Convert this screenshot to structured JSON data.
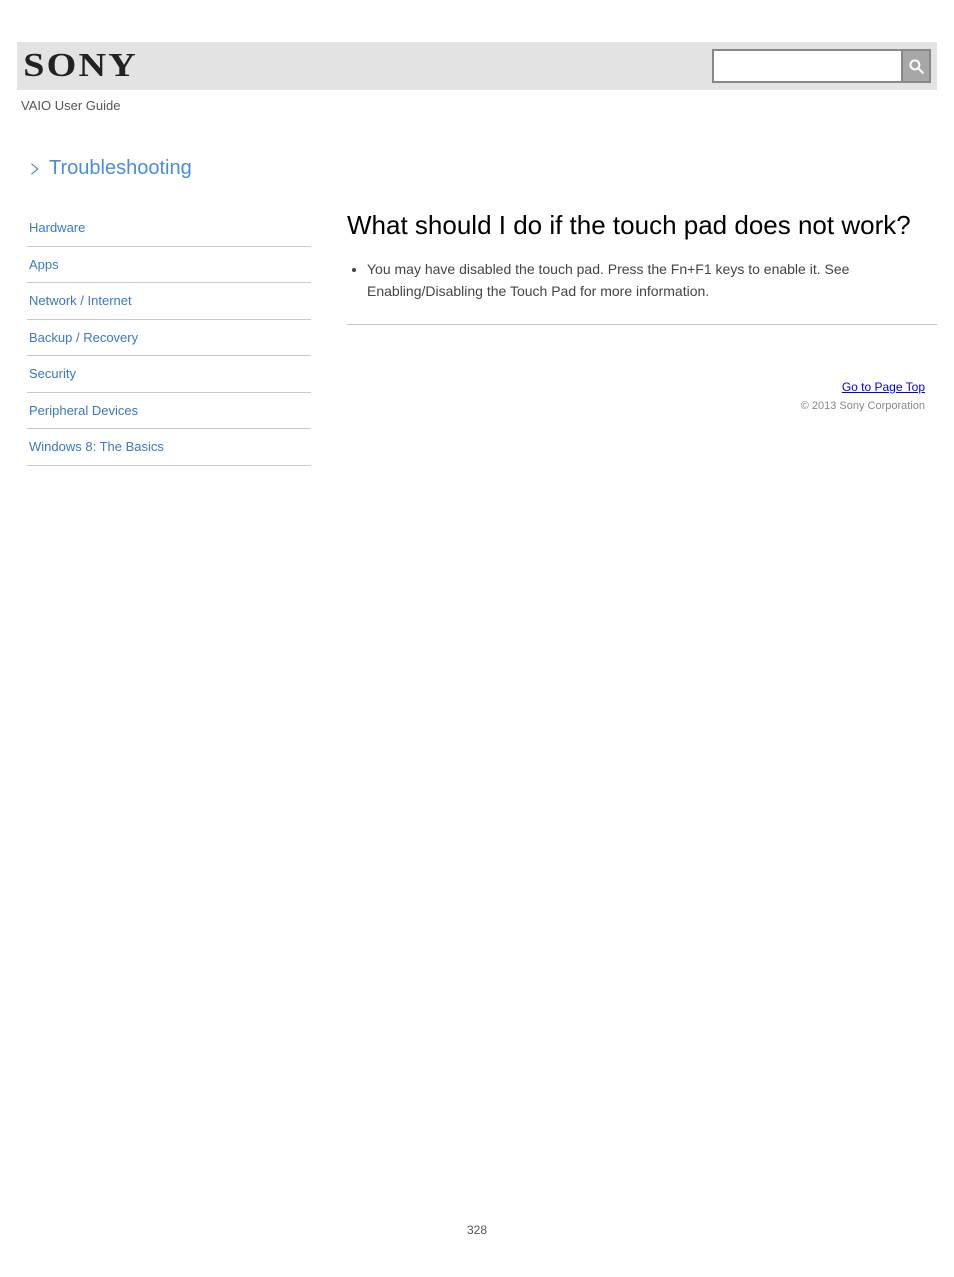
{
  "header": {
    "brand": "SONY",
    "search_value": "",
    "search_placeholder": ""
  },
  "product_line": "VAIO User Guide",
  "troubleshooting": {
    "label": "Troubleshooting"
  },
  "sidebar": {
    "items": [
      {
        "label": "Hardware"
      },
      {
        "label": "Apps"
      },
      {
        "label": "Network / Internet"
      },
      {
        "label": "Backup / Recovery"
      },
      {
        "label": "Security"
      },
      {
        "label": "Peripheral Devices"
      },
      {
        "label": "Windows 8: The Basics"
      }
    ]
  },
  "main": {
    "title": "What should I do if the touch pad does not work?",
    "bullets": [
      "You may have disabled the touch pad. Press the Fn+F1 keys to enable it. See Enabling/Disabling the Touch Pad for more information."
    ]
  },
  "footer": {
    "links": [
      "Go to Page Top"
    ],
    "copyright": "© 2013 Sony Corporation"
  },
  "page_number": "328"
}
